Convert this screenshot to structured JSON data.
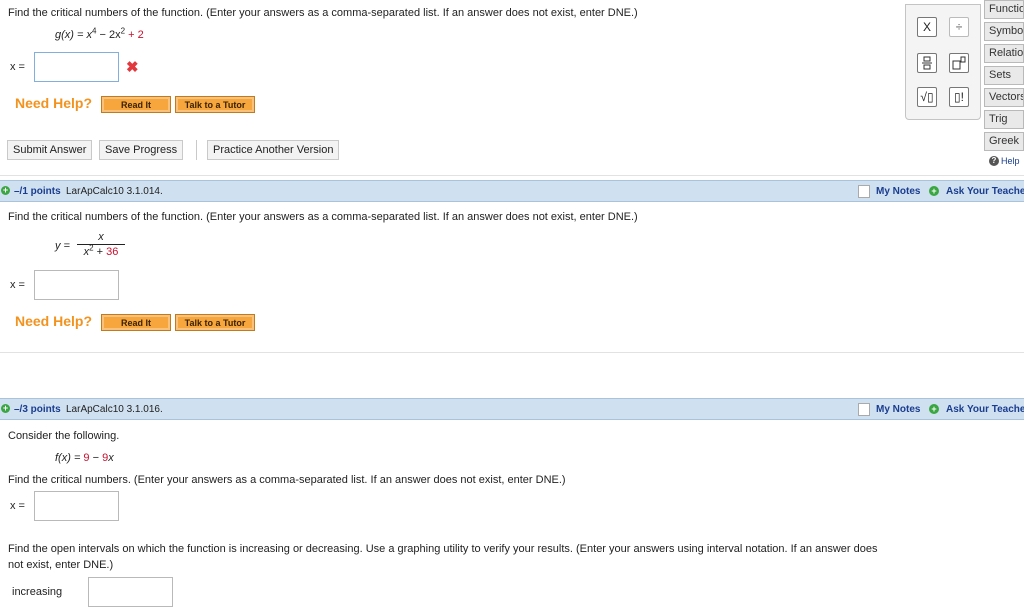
{
  "q1": {
    "prompt": "Find the critical numbers of the function. (Enter your answers as a comma-separated list. If an answer does not exist, enter DNE.)",
    "func_lhs": "g(x) = x",
    "func_exp1": "4",
    "func_mid": " − 2x",
    "func_exp2": "2",
    "func_const": " + 2",
    "x_label": "x =",
    "wrong_mark": "✖",
    "need_help": "Need Help?",
    "read_it": "Read It",
    "talk_tutor": "Talk to a Tutor",
    "submit": "Submit Answer",
    "save": "Save Progress",
    "practice": "Practice Another Version"
  },
  "palette": {
    "times": "X",
    "divide": "÷",
    "sqrt": "√▯",
    "fact": "▯!",
    "tabs": [
      "Functio",
      "Symbo",
      "Relatio",
      "Sets",
      "Vectors",
      "Trig",
      "Greek"
    ],
    "help": "Help",
    "help_icon": "?"
  },
  "q2": {
    "plus": "+",
    "points": "–/1 points",
    "qid": "LarApCalc10 3.1.014.",
    "my_notes": "My Notes",
    "ask_teacher": "Ask Your Teacher",
    "prompt": "Find the critical numbers of the function. (Enter your answers as a comma-separated list. If an answer does not exist, enter DNE.)",
    "y_label": "y =",
    "numer": "x",
    "denom_var": "x",
    "denom_exp": "2",
    "denom_plus": " + ",
    "denom_const": "36",
    "x_label": "x =",
    "need_help": "Need Help?",
    "read_it": "Read It",
    "talk_tutor": "Talk to a Tutor"
  },
  "q3": {
    "plus": "+",
    "points": "–/3 points",
    "qid": "LarApCalc10 3.1.016.",
    "my_notes": "My Notes",
    "ask_teacher": "Ask Your Teacher",
    "intro": "Consider the following.",
    "func_lhs": "f(x) = ",
    "func_a": "9",
    "func_mid": " − ",
    "func_b": "9",
    "func_var": "x",
    "prompt_critical": "Find the critical numbers. (Enter your answers as a comma-separated list. If an answer does not exist, enter DNE.)",
    "x_label": "x =",
    "prompt_intervals_1": "Find the open intervals on which the function is increasing or decreasing. Use a graphing utility to verify your results. (Enter your answers using interval notation. If an answer does",
    "prompt_intervals_2": "not exist, enter DNE.)",
    "increasing_label": "increasing"
  },
  "colors": {
    "accent_red": "#c8102e",
    "need_help_orange": "#f3931f",
    "link_blue": "#1a3d8f",
    "bar_blue": "#cfe0f0"
  }
}
